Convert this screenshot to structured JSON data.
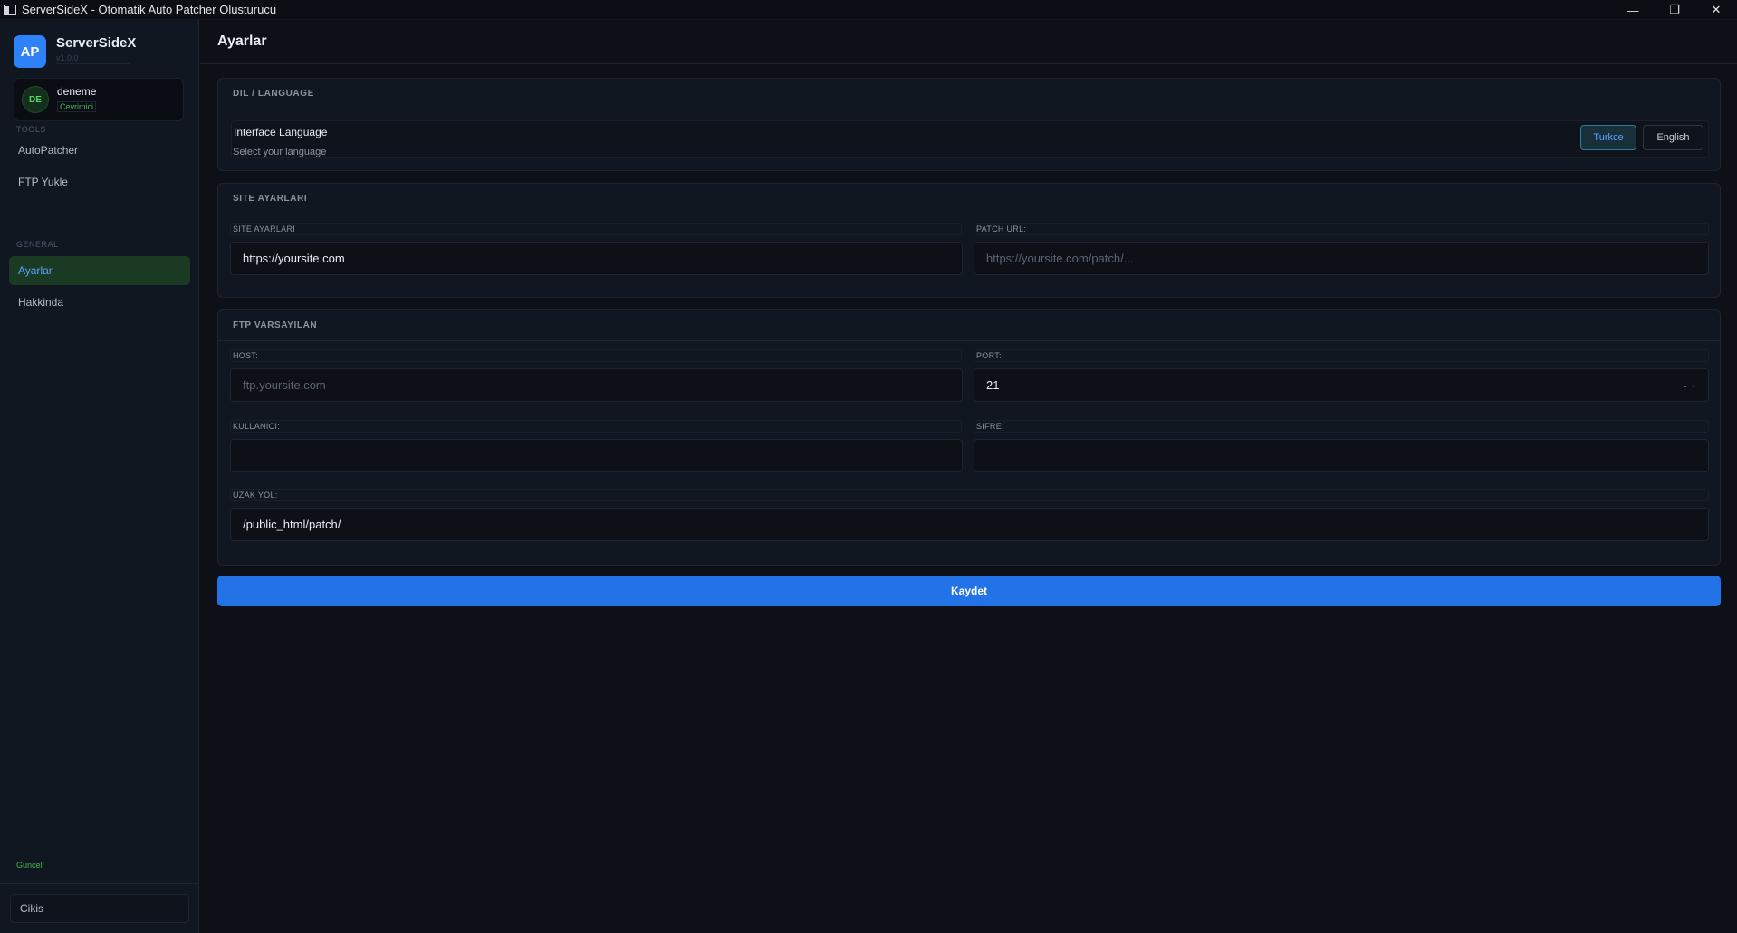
{
  "window": {
    "title": "ServerSideX - Otomatik Auto Patcher Olusturucu",
    "minimize": "—",
    "maximize": "❐",
    "close": "✕"
  },
  "sidebar": {
    "brand": {
      "logo": "AP",
      "name": "ServerSideX",
      "version": "v1.0.0"
    },
    "user": {
      "initials": "DE",
      "name": "deneme",
      "status": "Cevrimici"
    },
    "sections": {
      "tools": "TOOLS",
      "general": "GENERAL"
    },
    "items": [
      {
        "label": "AutoPatcher"
      },
      {
        "label": "FTP Yukle"
      },
      {
        "label": "Ayarlar",
        "active": true
      },
      {
        "label": "Hakkinda"
      }
    ],
    "update_status": "Guncel!",
    "logout": "Cikis"
  },
  "main": {
    "title": "Ayarlar",
    "language": {
      "header": "DIL / LANGUAGE",
      "title": "Interface Language",
      "subtitle": "Select your language",
      "options": [
        "Turkce",
        "English"
      ],
      "selected": "Turkce"
    },
    "site": {
      "header": "SITE AYARLARI",
      "site_label": "SITE AYARLARI",
      "site_value": "https://yoursite.com",
      "patch_label": "PATCH URL:",
      "patch_placeholder": "https://yoursite.com/patch/..."
    },
    "ftp": {
      "header": "FTP VARSAYILAN",
      "host_label": "HOST:",
      "host_placeholder": "ftp.yoursite.com",
      "port_label": "PORT:",
      "port_value": "21",
      "user_label": "KULLANICI:",
      "user_value": "",
      "pass_label": "SIFRE:",
      "pass_value": "",
      "remote_label": "UZAK YOL:",
      "remote_value": "/public_html/patch/"
    },
    "save": "Kaydet"
  },
  "colors": {
    "accent": "#2272e8",
    "active_nav_bg": "#1b3a24",
    "online": "#3fb950",
    "background": "#0d1117"
  }
}
